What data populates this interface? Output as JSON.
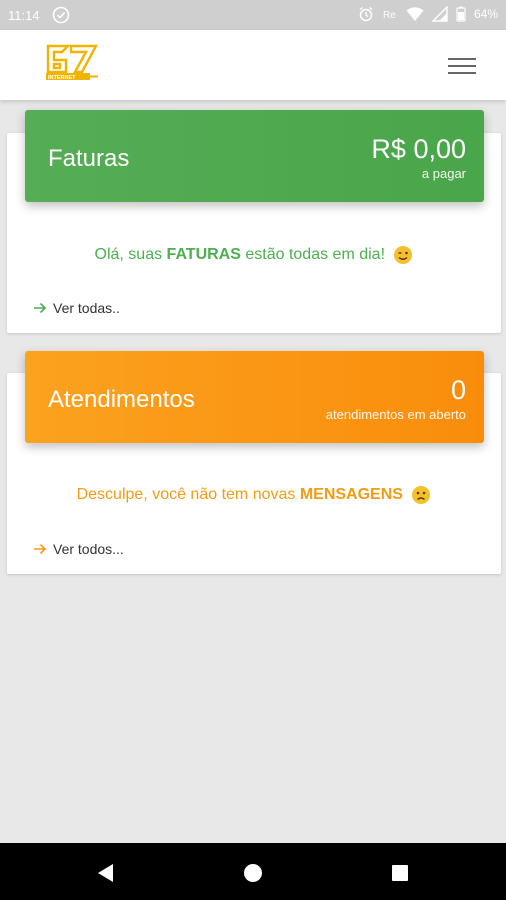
{
  "status_bar": {
    "time": "11:14",
    "battery": "64%"
  },
  "header": {
    "logo_text": "67",
    "logo_subtext": "INTERNET"
  },
  "faturas": {
    "title": "Faturas",
    "amount": "R$ 0,00",
    "amount_label": "a pagar",
    "message_prefix": "Olá, suas ",
    "message_bold": "FATURAS",
    "message_suffix": " estão todas em dia!",
    "link": "Ver todas..",
    "color": "#4caf50"
  },
  "atendimentos": {
    "title": "Atendimentos",
    "count": "0",
    "count_label": "atendimentos em aberto",
    "message_prefix": "Desculpe, você não tem novas ",
    "message_bold": "MENSAGENS",
    "link": "Ver todos...",
    "color": "#fb9a1a"
  }
}
